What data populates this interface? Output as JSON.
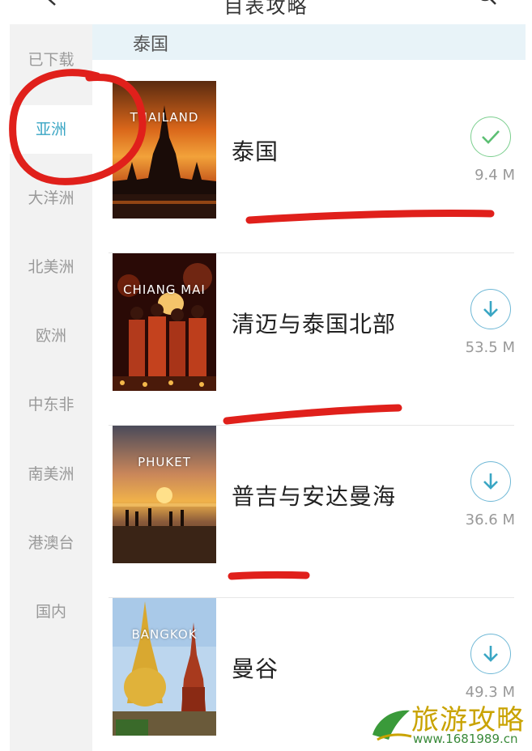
{
  "header": {
    "title": "目表攻略",
    "back_icon": "chevron-left-icon",
    "search_icon": "search-icon"
  },
  "sidebar": {
    "items": [
      {
        "label": "已下载",
        "active": false
      },
      {
        "label": "亚洲",
        "active": true
      },
      {
        "label": "大洋洲",
        "active": false
      },
      {
        "label": "北美洲",
        "active": false
      },
      {
        "label": "欧洲",
        "active": false
      },
      {
        "label": "中东非",
        "active": false
      },
      {
        "label": "南美洲",
        "active": false
      },
      {
        "label": "港澳台",
        "active": false
      },
      {
        "label": "国内",
        "active": false
      }
    ]
  },
  "section": {
    "title": "泰国"
  },
  "guides": [
    {
      "title": "泰国",
      "cover_label": "THAILAND",
      "size": "9.4 M",
      "status": "downloaded",
      "status_icon": "check-icon"
    },
    {
      "title": "清迈与泰国北部",
      "cover_label": "CHIANG MAI",
      "size": "53.5 M",
      "status": "not-downloaded",
      "status_icon": "download-arrow-icon"
    },
    {
      "title": "普吉与安达曼海",
      "cover_label": "PHUKET",
      "size": "36.6 M",
      "status": "not-downloaded",
      "status_icon": "download-arrow-icon"
    },
    {
      "title": "曼谷",
      "cover_label": "BANGKOK",
      "size": "49.3 M",
      "status": "not-downloaded",
      "status_icon": "download-arrow-icon"
    }
  ],
  "colors": {
    "accent": "#3aa6c4",
    "check": "#5cbf73",
    "annotation": "#e0201b",
    "sidebar_bg": "#f2f2f2",
    "section_bg": "#e8f3f8"
  },
  "watermark": {
    "text": "旅游攻略",
    "url": "www.1681989.cn"
  }
}
